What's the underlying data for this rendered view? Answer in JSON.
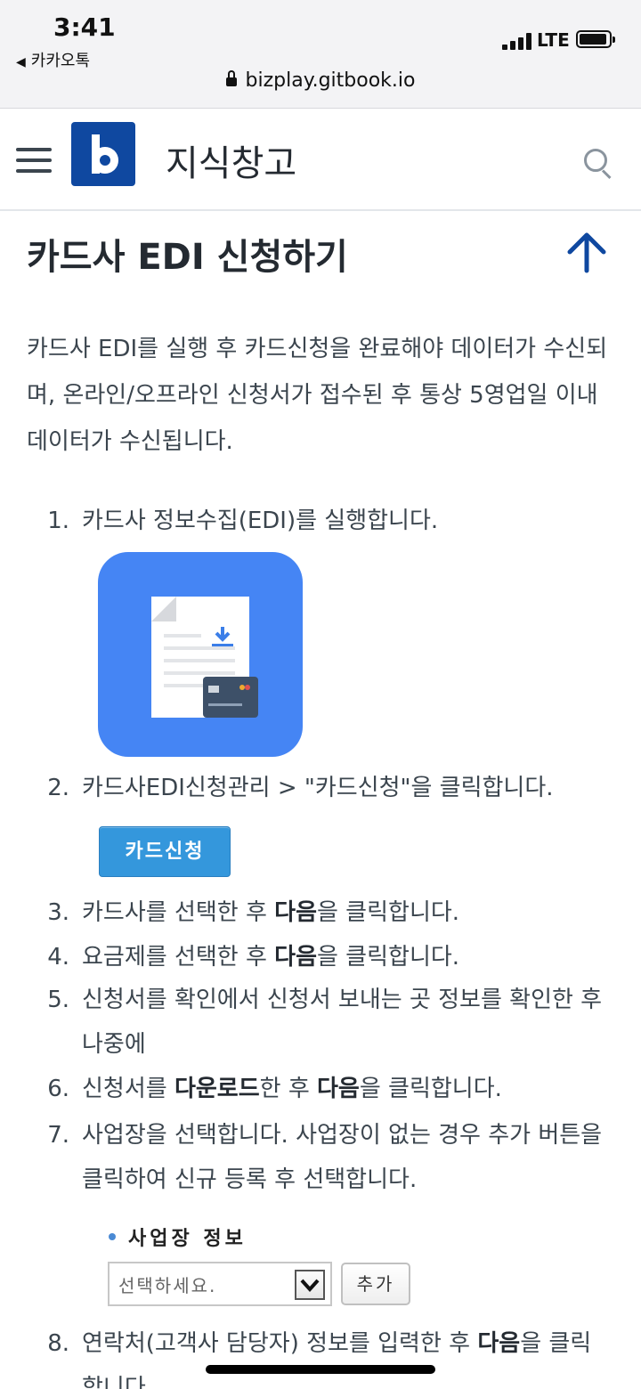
{
  "status": {
    "time": "3:41",
    "back_app": "카카오톡",
    "network": "LTE",
    "url": "bizplay.gitbook.io"
  },
  "header": {
    "site_title": "지식창고"
  },
  "article": {
    "title": "카드사 EDI 신청하기",
    "intro": "카드사 EDI를 실행 후 카드신청을 완료해야 데이터가 수신되며, 온라인/오프라인 신청서가 접수된 후 통상 5영업일 이내 데이터가 수신됩니다.",
    "steps": [
      {
        "num": "1.",
        "parts": [
          "카드사 정보수집(EDI)를 실행합니다."
        ]
      },
      {
        "num": "2.",
        "parts": [
          "카드사EDI신청관리 > \"카드신청\"을 클릭합니다."
        ]
      },
      {
        "num": "3.",
        "parts": [
          "카드사를 선택한 후 ",
          "다음",
          "을 클릭합니다."
        ]
      },
      {
        "num": "4.",
        "parts": [
          "요금제를 선택한 후 ",
          "다음",
          "을 클릭합니다."
        ]
      },
      {
        "num": "5.",
        "parts": [
          "신청서를 확인에서 신청서 보내는 곳 정보를 확인한 후 나중에"
        ]
      },
      {
        "num": "6.",
        "parts": [
          "신청서를 ",
          "다운로드",
          "한 후 ",
          "다음",
          "을 클릭합니다."
        ]
      },
      {
        "num": "7.",
        "parts": [
          "사업장을 선택합니다. 사업장이 없는 경우 추가 버튼을 클릭하여 신규 등록 후 선택합니다."
        ]
      },
      {
        "num": "8.",
        "parts": [
          "연락처(고객사 담당자) 정보를 입력한 후 ",
          "다음",
          "을 클릭합니다."
        ]
      }
    ],
    "card_request_button": "카드신청",
    "business_info": {
      "label": "사업장 정보",
      "select_value": "선택하세요.",
      "add_button": "추가"
    }
  },
  "colors": {
    "brand": "#0f48a0",
    "accent_blue": "#4585f4",
    "button_blue": "#3497dc",
    "heading": "#242a31",
    "body_text": "#3b454e"
  },
  "icons": [
    "hamburger-icon",
    "search-icon",
    "arrow-up-icon",
    "lock-icon",
    "document-download-icon",
    "credit-card-icon",
    "chevron-down-icon"
  ]
}
